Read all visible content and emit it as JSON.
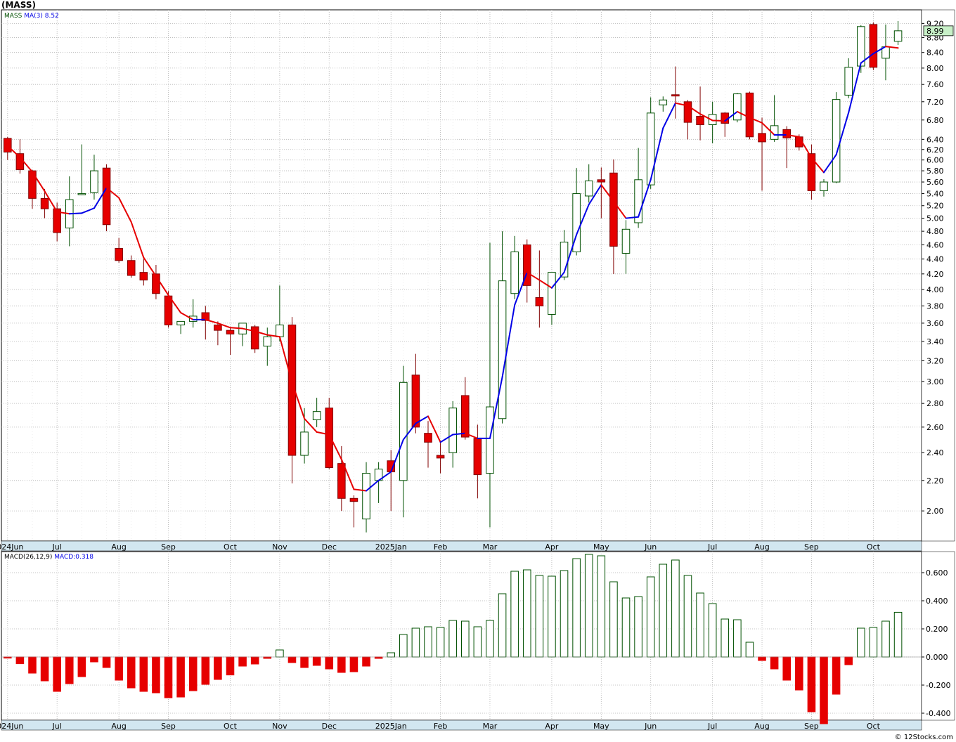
{
  "title": "(MASS)",
  "copyright": "© 12Stocks.com",
  "colors": {
    "up_body": "#ffffff",
    "up_border": "#005000",
    "down_body": "#e60000",
    "down_border": "#800000",
    "ma_up": "#0000e6",
    "ma_down": "#e60000",
    "grid": "#b4b4b4",
    "macd_pos": "#005000",
    "macd_neg": "#e60000",
    "last_price_bg": "#c8f0c8"
  },
  "chart_data": [
    {
      "type": "candlestick",
      "legend": {
        "symbol": "MASS",
        "ma_label": "MA(3)",
        "ma_value": "8.52"
      },
      "y_scale": "log",
      "ylim": [
        1.82,
        9.6
      ],
      "y_ticks": [
        "9.20",
        "8.80",
        "8.40",
        "8.00",
        "7.60",
        "7.20",
        "6.80",
        "6.40",
        "6.20",
        "6.00",
        "5.80",
        "5.60",
        "5.40",
        "5.20",
        "5.00",
        "4.80",
        "4.60",
        "4.40",
        "4.20",
        "4.00",
        "3.80",
        "3.60",
        "3.40",
        "3.20",
        "3.00",
        "2.80",
        "2.60",
        "2.40",
        "2.20",
        "2.00"
      ],
      "last_price_label": "8.99",
      "x_labels": [
        {
          "i": 0,
          "text": "2024Jun"
        },
        {
          "i": 4,
          "text": "Jul"
        },
        {
          "i": 9,
          "text": "Aug"
        },
        {
          "i": 13,
          "text": "Sep"
        },
        {
          "i": 18,
          "text": "Oct"
        },
        {
          "i": 22,
          "text": "Nov"
        },
        {
          "i": 26,
          "text": "Dec"
        },
        {
          "i": 31,
          "text": "2025Jan"
        },
        {
          "i": 35,
          "text": "Feb"
        },
        {
          "i": 39,
          "text": "Mar"
        },
        {
          "i": 44,
          "text": "Apr"
        },
        {
          "i": 48,
          "text": "May"
        },
        {
          "i": 52,
          "text": "Jun"
        },
        {
          "i": 57,
          "text": "Jul"
        },
        {
          "i": 61,
          "text": "Aug"
        },
        {
          "i": 65,
          "text": "Sep"
        },
        {
          "i": 70,
          "text": "Oct"
        }
      ],
      "ohlc": [
        [
          6.42,
          6.45,
          6.0,
          6.15
        ],
        [
          6.12,
          6.4,
          5.75,
          5.82
        ],
        [
          5.8,
          5.82,
          5.15,
          5.32
        ],
        [
          5.32,
          5.48,
          5.0,
          5.15
        ],
        [
          5.15,
          5.25,
          4.65,
          4.78
        ],
        [
          4.85,
          5.7,
          4.58,
          5.3
        ],
        [
          5.4,
          6.3,
          5.38,
          5.4
        ],
        [
          5.42,
          6.1,
          5.3,
          5.8
        ],
        [
          5.85,
          5.92,
          4.8,
          4.9
        ],
        [
          4.55,
          4.7,
          4.35,
          4.38
        ],
        [
          4.38,
          4.45,
          4.15,
          4.18
        ],
        [
          4.22,
          4.4,
          4.05,
          4.12
        ],
        [
          4.2,
          4.32,
          3.88,
          3.95
        ],
        [
          3.92,
          3.98,
          3.55,
          3.58
        ],
        [
          3.58,
          3.62,
          3.48,
          3.62
        ],
        [
          3.62,
          3.88,
          3.55,
          3.68
        ],
        [
          3.72,
          3.8,
          3.42,
          3.63
        ],
        [
          3.58,
          3.62,
          3.36,
          3.52
        ],
        [
          3.52,
          3.56,
          3.26,
          3.48
        ],
        [
          3.48,
          3.6,
          3.35,
          3.6
        ],
        [
          3.56,
          3.58,
          3.28,
          3.32
        ],
        [
          3.35,
          3.55,
          3.15,
          3.45
        ],
        [
          3.45,
          4.05,
          3.4,
          3.58
        ],
        [
          3.58,
          3.67,
          2.18,
          2.38
        ],
        [
          2.38,
          2.76,
          2.32,
          2.56
        ],
        [
          2.66,
          2.85,
          2.6,
          2.73
        ],
        [
          2.76,
          2.85,
          2.28,
          2.29
        ],
        [
          2.32,
          2.45,
          2.0,
          2.08
        ],
        [
          2.08,
          2.1,
          1.9,
          2.06
        ],
        [
          1.95,
          2.33,
          1.87,
          2.25
        ],
        [
          2.2,
          2.33,
          2.05,
          2.28
        ],
        [
          2.34,
          2.42,
          2.0,
          2.26
        ],
        [
          2.2,
          3.15,
          1.96,
          2.99
        ],
        [
          3.06,
          3.27,
          2.55,
          2.6
        ],
        [
          2.55,
          2.65,
          2.29,
          2.48
        ],
        [
          2.38,
          2.48,
          2.25,
          2.36
        ],
        [
          2.4,
          2.82,
          2.29,
          2.76
        ],
        [
          2.87,
          3.04,
          2.5,
          2.52
        ],
        [
          2.51,
          2.62,
          2.08,
          2.24
        ],
        [
          2.25,
          4.63,
          1.9,
          2.77
        ],
        [
          2.67,
          4.8,
          2.63,
          4.11
        ],
        [
          3.95,
          4.73,
          3.88,
          4.5
        ],
        [
          4.6,
          4.68,
          3.84,
          4.05
        ],
        [
          3.9,
          4.52,
          3.55,
          3.8
        ],
        [
          3.7,
          4.2,
          3.58,
          4.22
        ],
        [
          4.16,
          4.82,
          4.12,
          4.64
        ],
        [
          4.5,
          5.85,
          4.45,
          5.4
        ],
        [
          5.36,
          5.92,
          5.25,
          5.62
        ],
        [
          5.64,
          5.86,
          5.0,
          5.6
        ],
        [
          5.76,
          6.01,
          4.2,
          4.58
        ],
        [
          4.48,
          4.97,
          4.2,
          4.83
        ],
        [
          4.93,
          6.23,
          4.85,
          5.64
        ],
        [
          5.55,
          7.3,
          5.48,
          6.95
        ],
        [
          7.13,
          7.32,
          6.98,
          7.24
        ],
        [
          7.36,
          8.04,
          6.83,
          7.33
        ],
        [
          7.2,
          7.24,
          6.4,
          6.75
        ],
        [
          6.88,
          7.55,
          6.38,
          6.7
        ],
        [
          6.7,
          7.2,
          6.32,
          6.92
        ],
        [
          6.95,
          6.97,
          6.45,
          6.73
        ],
        [
          6.8,
          7.4,
          6.75,
          7.38
        ],
        [
          7.4,
          7.43,
          6.4,
          6.45
        ],
        [
          6.52,
          6.85,
          5.45,
          6.35
        ],
        [
          6.4,
          7.35,
          6.35,
          6.68
        ],
        [
          6.6,
          6.67,
          5.85,
          6.43
        ],
        [
          6.45,
          6.5,
          6.18,
          6.25
        ],
        [
          6.12,
          6.3,
          5.3,
          5.45
        ],
        [
          5.45,
          5.65,
          5.35,
          5.6
        ],
        [
          5.6,
          7.42,
          5.58,
          7.25
        ],
        [
          7.35,
          8.25,
          7.28,
          8.02
        ],
        [
          8.05,
          9.15,
          7.88,
          9.11
        ],
        [
          9.17,
          9.23,
          7.95,
          8.02
        ],
        [
          8.25,
          9.17,
          7.7,
          8.55
        ],
        [
          8.7,
          9.27,
          8.6,
          8.99
        ]
      ],
      "ma": [
        6.27,
        6.05,
        5.78,
        5.44,
        5.1,
        5.07,
        5.08,
        5.16,
        5.5,
        5.33,
        4.94,
        4.42,
        4.17,
        3.93,
        3.72,
        3.64,
        3.64,
        3.6,
        3.55,
        3.54,
        3.51,
        3.47,
        3.45,
        2.99,
        2.67,
        2.56,
        2.54,
        2.35,
        2.14,
        2.13,
        2.2,
        2.26,
        2.5,
        2.63,
        2.69,
        2.48,
        2.54,
        2.55,
        2.51,
        2.51,
        3.04,
        3.81,
        4.22,
        4.12,
        4.02,
        4.22,
        4.75,
        5.22,
        5.55,
        5.27,
        5.0,
        5.02,
        5.64,
        6.63,
        7.17,
        7.11,
        6.93,
        6.79,
        6.78,
        6.98,
        6.85,
        6.74,
        6.49,
        6.49,
        6.45,
        6.04,
        5.77,
        6.1,
        6.96,
        8.13,
        8.37,
        8.56,
        8.52
      ],
      "xlim": [
        -0.5,
        73.9
      ]
    },
    {
      "type": "bar",
      "legend": {
        "label": "MACD(26,12,9)",
        "value_label": "MACD:0.318"
      },
      "ylim": [
        -0.45,
        0.75
      ],
      "y_ticks": [
        "0.600",
        "0.400",
        "0.200",
        "0.000",
        "-0.200",
        "-0.400"
      ],
      "y_tick_values": [
        0.6,
        0.4,
        0.2,
        0.0,
        -0.2,
        -0.4
      ],
      "values": [
        -0.008,
        -0.048,
        -0.115,
        -0.17,
        -0.245,
        -0.19,
        -0.14,
        -0.035,
        -0.075,
        -0.165,
        -0.22,
        -0.245,
        -0.255,
        -0.29,
        -0.285,
        -0.24,
        -0.195,
        -0.16,
        -0.128,
        -0.065,
        -0.05,
        -0.01,
        0.05,
        -0.04,
        -0.075,
        -0.06,
        -0.085,
        -0.11,
        -0.105,
        -0.065,
        -0.01,
        0.03,
        0.16,
        0.205,
        0.215,
        0.21,
        0.26,
        0.255,
        0.215,
        0.26,
        0.45,
        0.61,
        0.62,
        0.58,
        0.575,
        0.615,
        0.7,
        0.73,
        0.72,
        0.535,
        0.42,
        0.43,
        0.57,
        0.66,
        0.69,
        0.58,
        0.455,
        0.38,
        0.27,
        0.265,
        0.105,
        -0.025,
        -0.085,
        -0.165,
        -0.235,
        -0.39,
        -0.475,
        -0.265,
        -0.055,
        0.205,
        0.21,
        0.255,
        0.318
      ]
    }
  ]
}
